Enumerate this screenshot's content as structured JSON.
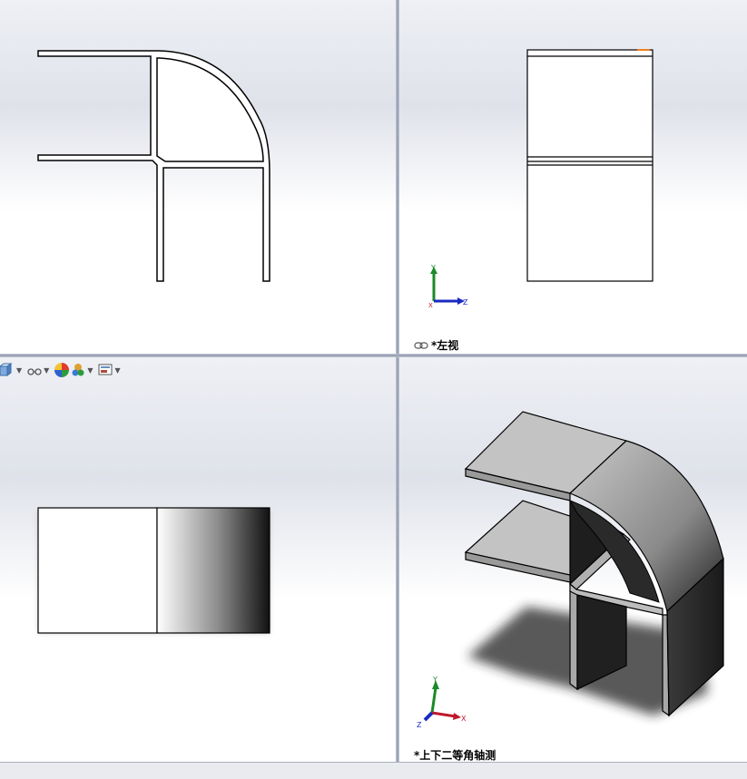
{
  "viewports": {
    "top_left": {
      "name": "front-view"
    },
    "top_right": {
      "name": "left-view",
      "label": "*左视"
    },
    "bottom_left": {
      "name": "top-view"
    },
    "bottom_right": {
      "name": "isometric-view",
      "label": "*上下二等角轴测"
    }
  },
  "triad_labels": {
    "x": "X",
    "y": "Y",
    "z": "Z"
  },
  "toolbar": {
    "items": [
      {
        "icon": "view-orientation-icon"
      },
      {
        "icon": "hide-show-items-icon"
      },
      {
        "icon": "edit-appearance-icon"
      },
      {
        "icon": "apply-scene-icon"
      },
      {
        "icon": "view-settings-icon"
      }
    ]
  },
  "colors": {
    "edge": "#000000",
    "face_light": "#c8c8c8",
    "face_dark": "#1e1e1e",
    "triad_x": "#c0182a",
    "triad_y": "#1a8a2a",
    "triad_z": "#1a2ac0",
    "highlight": "#f08020"
  }
}
